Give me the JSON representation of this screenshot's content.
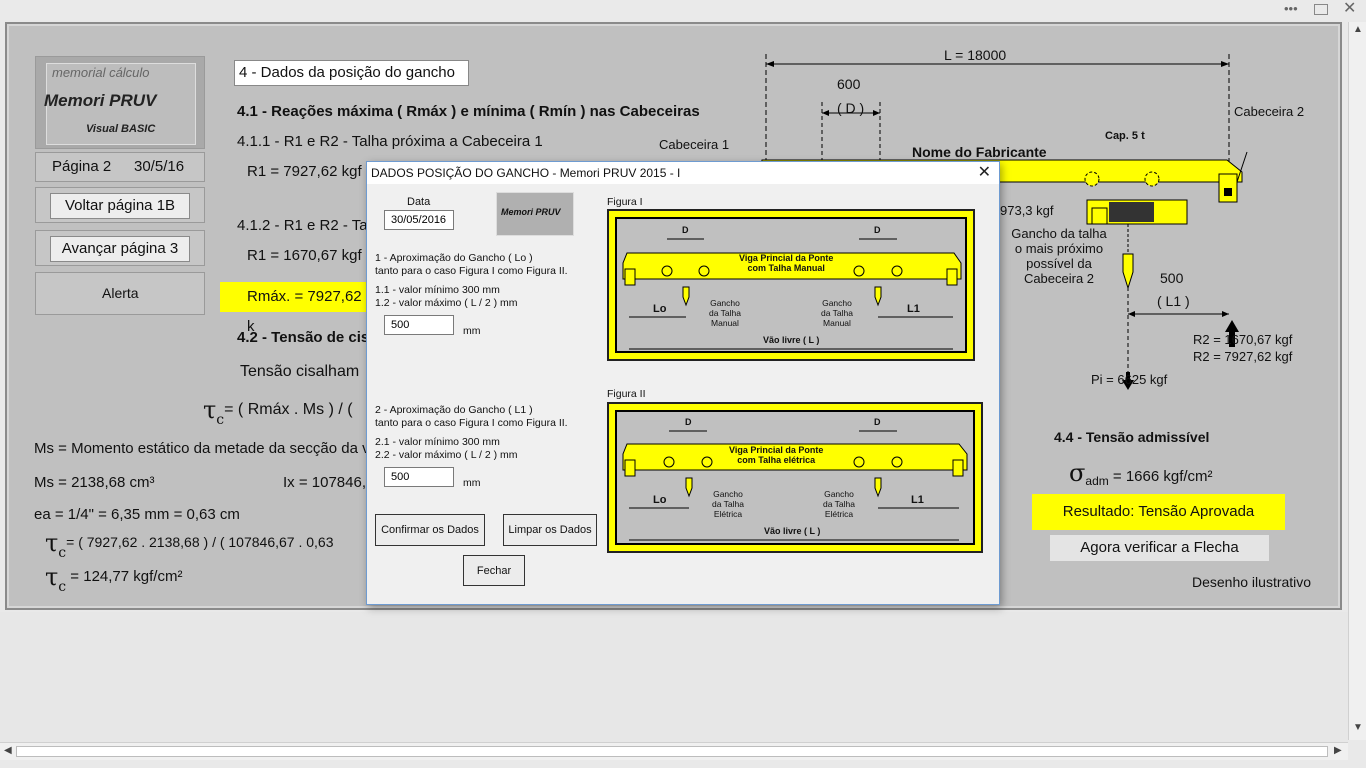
{
  "window": {
    "menu_dots": "•••"
  },
  "logo": {
    "line1": "memorial  cálculo",
    "brand": "Memori  PRUV",
    "sub": "Visual BASIC"
  },
  "left_panel": {
    "page_info": "Página 2",
    "page_date": "30/5/16",
    "back_button": "Voltar página 1B",
    "forward_button": "Avançar página 3",
    "alert_button": "Alerta"
  },
  "sheet": {
    "section_title": "4 - Dados da posição do gancho",
    "heading_41": "4.1 - Reações máxima ( Rmáx ) e mínima ( Rmín ) nas Cabeceiras",
    "item_411": "4.1.1 - R1 e  R2 - Talha próxima a Cabeceira 1",
    "r1_max": "R1 = 7927,62 kgf",
    "item_412": "4.1.2 - R1 e R2 - Ta",
    "r1_min": "R1 = 1670,67 kgf",
    "rmax_box": "Rmáx. = 7927,62 k",
    "heading_42": "4.2 - Tensão de cis",
    "tensao_label": "Tensão cisalham",
    "tau_formula": "= ( Rmáx . Ms ) / (",
    "ms_desc": "Ms = Momento estático da metade da secção da v",
    "ms_value": "Ms = 2138,68 cm³",
    "ix_value": "Ix = 107846,6",
    "ea_value": "ea = 1/4\" = 6,35 mm = 0,63 cm",
    "tau_calc": "= ( 7927,62 . 2138,68 ) / ( 107846,67 . 0,63",
    "tau_result": "124,77 kgf/cm²",
    "heading_44": "4.4 - Tensão admissível",
    "sigma_value": "1666 kgf/cm²",
    "result_box": "Resultado: Tensão Aprovada",
    "flecha_button": "Agora verificar a Flecha",
    "drawing_note": "Desenho ilustrativo"
  },
  "drawing": {
    "L": "L = 18000",
    "d_value": "600",
    "d_label": "( D )",
    "cab1": "Cabeceira 1",
    "cab2": "Cabeceira 2",
    "cap": "Cap. 5 t",
    "manufacturer": "Nome do Fabricante",
    "partial_value": "973,3 kgf",
    "hook_note1": "Gancho da talha",
    "hook_note2": "o mais próximo",
    "hook_note3": "possível da",
    "hook_note4": "Cabeceira 2",
    "l1_value": "500",
    "l1_label": "( L1 )",
    "r2_a": "R2 = 1670,67 kgf",
    "r2_b": "R2 = 7927,62 kgf",
    "pi": "Pi = 6625 kgf"
  },
  "dialog": {
    "title": "DADOS POSIÇÃO DO GANCHO - Memori PRUV 2015 - I",
    "close": "✕",
    "data_label": "Data",
    "date_value": "30/05/2016",
    "sec1_l1": "1 - Aproximação do Gancho ( Lo )",
    "sec1_l2": "tanto para o caso Figura I como Figura II.",
    "sec1_min": "1.1 - valor mínimo 300 mm",
    "sec1_max": "1.2 - valor máximo ( L / 2 ) mm",
    "lo_value": "500",
    "unit1": "mm",
    "sec2_l1": "2 - Aproximação do Gancho ( L1 )",
    "sec2_l2": "tanto para o  caso Figura I como Figura II.",
    "sec2_min": "2.1 - valor mínimo 300 mm",
    "sec2_max": "2.2 - valor máximo ( L / 2 ) mm",
    "l1_value": "500",
    "unit2": "mm",
    "confirm": "Confirmar os Dados",
    "clear": "Limpar os Dados",
    "close_btn": "Fechar",
    "fig1_title": "Figura I",
    "fig1_beam": "Viga Princial da Ponte",
    "fig1_beam2": "com Talha Manual",
    "fig1_hook": "Gancho",
    "fig1_hook2": "da Talha",
    "fig1_hook3": "Manual",
    "fig2_title": "Figura II",
    "fig2_beam": "Viga Princial da Ponte",
    "fig2_beam2": "com Talha elétrica",
    "fig2_hook3": "Elétrica",
    "d": "D",
    "lo": "Lo",
    "l1": "L1",
    "vao": "Vão livre ( L )"
  }
}
